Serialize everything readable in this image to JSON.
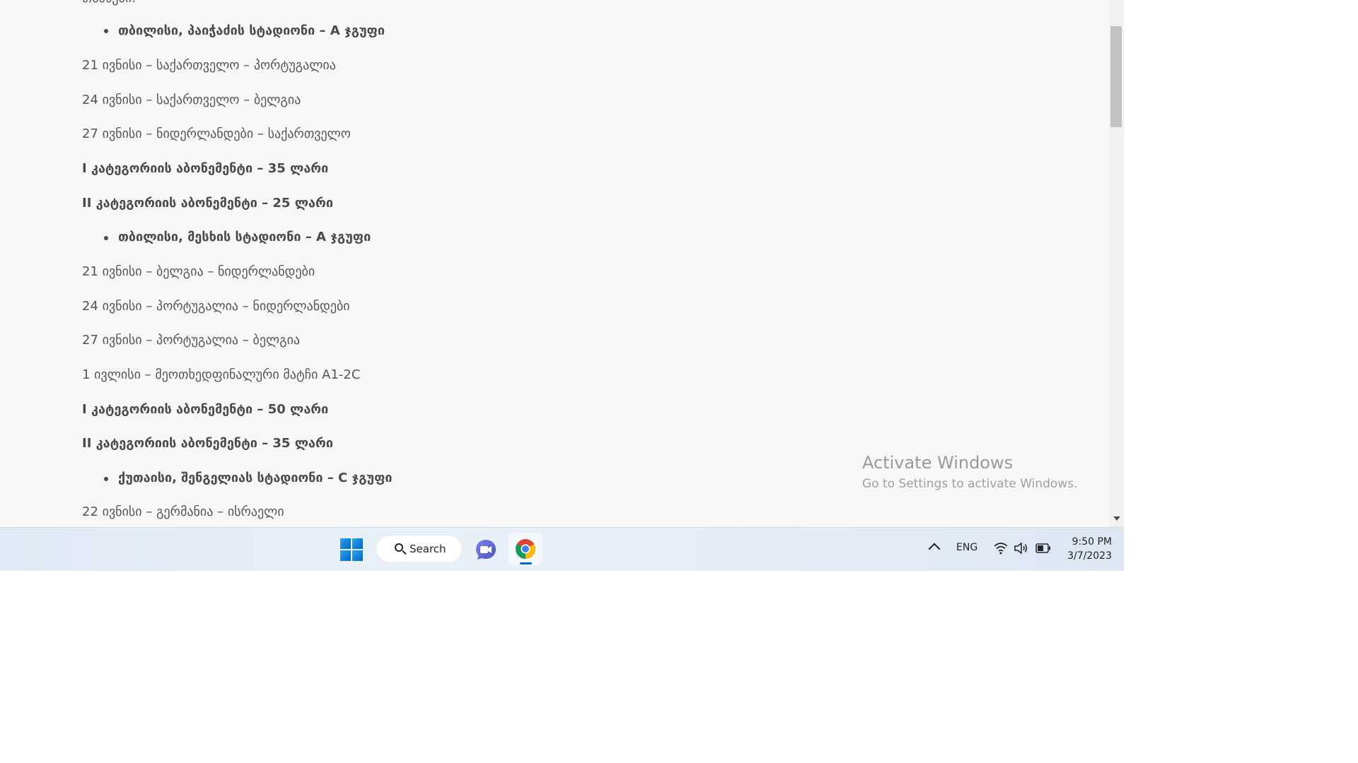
{
  "content": {
    "cut_off_top": "თანხები:",
    "lines": [
      {
        "text": "თბილისი, პაიჭაძის სტადიონი – A ჯგუფი",
        "bold": true,
        "bullet": true
      },
      {
        "text": "21 ივნისი – საქართველო – პორტუგალია",
        "bold": false,
        "bullet": false
      },
      {
        "text": "24 ივნისი – საქართველო – ბელგია",
        "bold": false,
        "bullet": false
      },
      {
        "text": "27 ივნისი – ნიდერლანდები – საქართველო",
        "bold": false,
        "bullet": false
      },
      {
        "text": "I კატეგორიის აბონემენტი – 35 ლარი",
        "bold": true,
        "bullet": false
      },
      {
        "text": "II კატეგორიის აბონემენტი – 25 ლარი",
        "bold": true,
        "bullet": false
      },
      {
        "text": "თბილისი, მესხის სტადიონი – A ჯგუფი",
        "bold": true,
        "bullet": true
      },
      {
        "text": "21 ივნისი – ბელგია – ნიდერლანდები",
        "bold": false,
        "bullet": false
      },
      {
        "text": "24 ივნისი – პორტუგალია – ნიდერლანდები",
        "bold": false,
        "bullet": false
      },
      {
        "text": "27 ივნისი – პორტუგალია – ბელგია",
        "bold": false,
        "bullet": false
      },
      {
        "text": "1 ივლისი – მეოთხედფინალური მატჩი A1-2C",
        "bold": false,
        "bullet": false
      },
      {
        "text": "I კატეგორიის აბონემენტი – 50 ლარი",
        "bold": true,
        "bullet": false
      },
      {
        "text": "II კატეგორიის აბონემენტი – 35 ლარი",
        "bold": true,
        "bullet": false
      },
      {
        "text": "ქუთაისი, შენგელიას სტადიონი – C ჯგუფი",
        "bold": true,
        "bullet": true
      },
      {
        "text": "22 ივნისი – გერმანია – ისრაელი",
        "bold": false,
        "bullet": false
      }
    ]
  },
  "watermark": {
    "title": "Activate Windows",
    "subtitle": "Go to Settings to activate Windows."
  },
  "taskbar": {
    "search_label": "Search",
    "language": "ENG",
    "time": "9:50 PM",
    "date": "3/7/2023",
    "icons": [
      "windows-start-icon",
      "search-icon",
      "meet-now-icon",
      "chrome-icon",
      "chevron-up-icon",
      "wifi-icon",
      "volume-icon",
      "battery-icon"
    ]
  },
  "colors": {
    "content_bg": "#f7f7f7",
    "text": "#555555",
    "bold_text": "#4a4a4a",
    "accent": "#0067c0"
  }
}
